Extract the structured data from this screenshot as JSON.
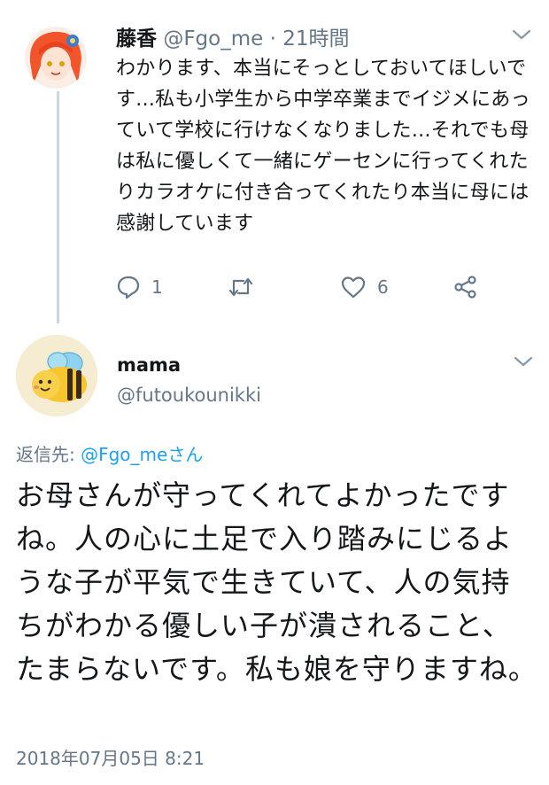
{
  "tweet1": {
    "display_name": "藤香",
    "handle": "@Fgo_me",
    "separator": " · ",
    "time": "21時間",
    "text": "わかります、本当にそっとしておいてほしいです...私も小学生から中学卒業までイジメにあっていて学校に行けなくなりました...それでも母は私に優しくて一緒にゲーセンに行ってくれたりカラオケに付き合ってくれたり本当に母には感謝しています",
    "reply_count": "1",
    "like_count": "6"
  },
  "tweet2": {
    "display_name": "mama",
    "handle": "@futoukounikki",
    "reply_prefix": "返信先: ",
    "reply_mention": "@Fgo_meさん",
    "text": "お母さんが守ってくれてよかったですね。人の心に土足で入り踏みにじるような子が平気で生きていて、人の気持ちがわかる優しい子が潰されること、たまらないです。私も娘を守りますね。",
    "timestamp": "2018年07月05日 8:21"
  },
  "icons": [
    "chevron-down-icon",
    "reply-icon",
    "retweet-icon",
    "like-icon",
    "share-icon"
  ],
  "colors": {
    "muted": "#657786",
    "link": "#1da1f2",
    "thread_line": "#ccd6dd"
  }
}
